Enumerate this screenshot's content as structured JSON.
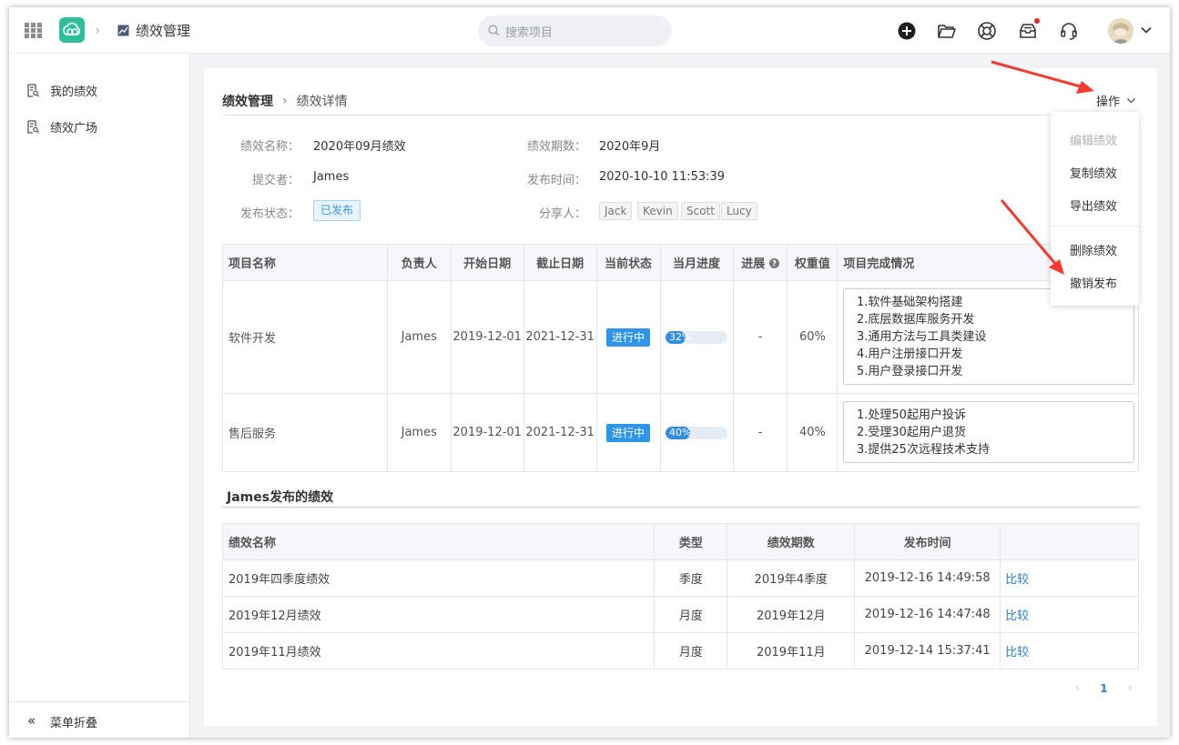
{
  "header": {
    "app_title": "绩效管理",
    "search_placeholder": "搜索项目"
  },
  "sidebar": {
    "items": [
      {
        "label": "我的绩效"
      },
      {
        "label": "绩效广场"
      }
    ],
    "collapse_label": "菜单折叠"
  },
  "breadcrumb": {
    "root": "绩效管理",
    "current": "绩效详情"
  },
  "ops_label": "操作",
  "info": {
    "name_label": "绩效名称：",
    "name_value": "2020年09月绩效",
    "period_label": "绩效期数：",
    "period_value": "2020年9月",
    "submitter_label": "提交者：",
    "submitter_value": "James",
    "publish_time_label": "发布时间：",
    "publish_time_value": "2020-10-10 11:53:39",
    "status_label": "发布状态：",
    "status_value": "已发布",
    "sharer_label": "分享人：",
    "sharers": [
      "Jack",
      "Kevin",
      "Scott",
      "Lucy"
    ]
  },
  "projects": {
    "headers": [
      "项目名称",
      "负责人",
      "开始日期",
      "截止日期",
      "当前状态",
      "当月进度",
      "进展",
      "权重值",
      "项目完成情况"
    ],
    "rows": [
      {
        "name": "软件开发",
        "owner": "James",
        "start": "2019-12-01",
        "end": "2021-12-31",
        "status": "进行中",
        "progress": 32,
        "progress_text": "32%",
        "trend": "-",
        "weight": "60%",
        "details": [
          "1.软件基础架构搭建",
          "2.底层数据库服务开发",
          "3.通用方法与工具类建设",
          "4.用户注册接口开发",
          "5.用户登录接口开发"
        ]
      },
      {
        "name": "售后服务",
        "owner": "James",
        "start": "2019-12-01",
        "end": "2021-12-31",
        "status": "进行中",
        "progress": 40,
        "progress_text": "40%",
        "trend": "-",
        "weight": "40%",
        "details": [
          "1.处理50起用户投诉",
          "2.受理30起用户退货",
          "3.提供25次远程技术支持"
        ]
      }
    ]
  },
  "history": {
    "title": "James发布的绩效",
    "headers": [
      "绩效名称",
      "类型",
      "绩效期数",
      "发布时间",
      ""
    ],
    "rows": [
      {
        "name": "2019年四季度绩效",
        "type": "季度",
        "period": "2019年4季度",
        "time": "2019-12-16 14:49:58",
        "action": "比较"
      },
      {
        "name": "2019年12月绩效",
        "type": "月度",
        "period": "2019年12月",
        "time": "2019-12-16 14:47:48",
        "action": "比较"
      },
      {
        "name": "2019年11月绩效",
        "type": "月度",
        "period": "2019年11月",
        "time": "2019-12-14 15:37:41",
        "action": "比较"
      }
    ]
  },
  "pagination": {
    "current": "1"
  },
  "ops_menu": {
    "items": [
      {
        "label": "编辑绩效",
        "disabled": true
      },
      {
        "label": "复制绩效",
        "disabled": false
      },
      {
        "label": "导出绩效",
        "disabled": false
      },
      {
        "label": "删除绩效",
        "disabled": false
      },
      {
        "label": "撤销发布",
        "disabled": false
      }
    ]
  },
  "colors": {
    "accent": "#2f95e8",
    "brand": "#2bbf9a",
    "annotation_arrow": "#f23a2f"
  }
}
